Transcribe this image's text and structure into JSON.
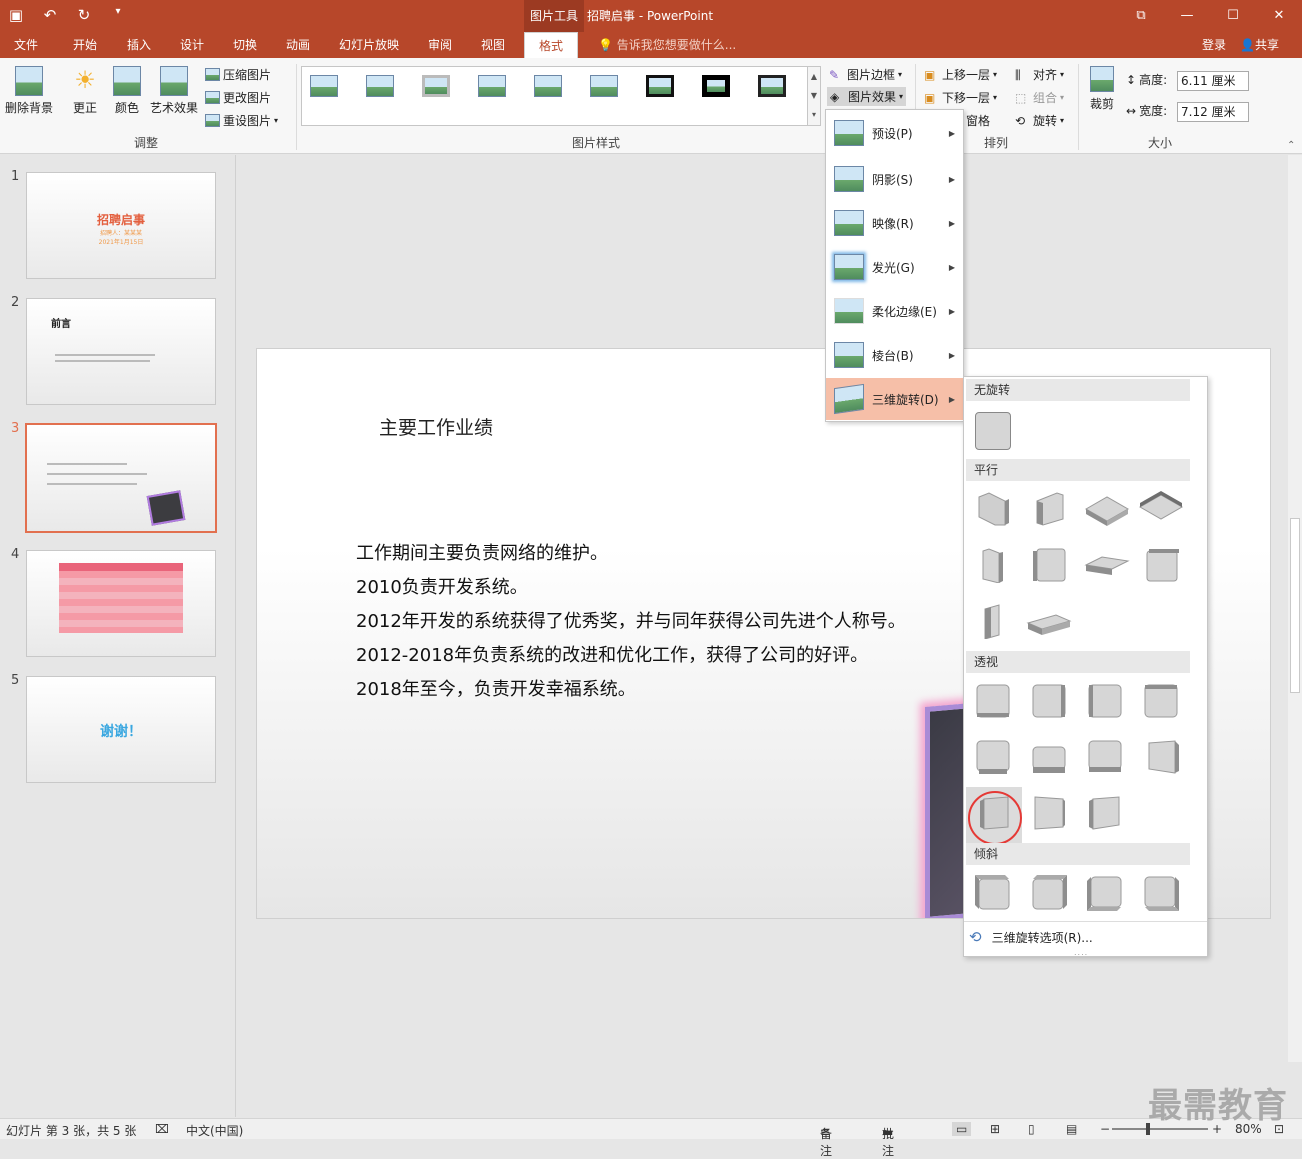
{
  "window": {
    "context_tab": "图片工具",
    "title": "招聘启事 - PowerPoint"
  },
  "tabs": [
    {
      "label": "文件"
    },
    {
      "label": "开始"
    },
    {
      "label": "插入"
    },
    {
      "label": "设计"
    },
    {
      "label": "切换"
    },
    {
      "label": "动画"
    },
    {
      "label": "幻灯片放映"
    },
    {
      "label": "审阅"
    },
    {
      "label": "视图"
    },
    {
      "label": "格式"
    }
  ],
  "tell_me": "告诉我您想要做什么...",
  "login": "登录",
  "share": "共享",
  "ribbon": {
    "remove_bg": "删除背景",
    "corrections": "更正",
    "color": "颜色",
    "artistic": "艺术效果",
    "compress": "压缩图片",
    "change": "更改图片",
    "reset": "重设图片",
    "group_adjust": "调整",
    "group_styles": "图片样式",
    "border": "图片边框",
    "effects": "图片效果",
    "bring_forward": "上移一层",
    "send_backward": "下移一层",
    "pane": "窗格",
    "align": "对齐",
    "group": "组合",
    "rotate": "旋转",
    "group_arrange": "排列",
    "crop": "裁剪",
    "height_label": "高度:",
    "height_value": "6.11 厘米",
    "width_label": "宽度:",
    "width_value": "7.12 厘米",
    "group_size": "大小"
  },
  "effects_menu": [
    {
      "label": "预设(P)"
    },
    {
      "label": "阴影(S)"
    },
    {
      "label": "映像(R)"
    },
    {
      "label": "发光(G)"
    },
    {
      "label": "柔化边缘(E)"
    },
    {
      "label": "棱台(B)"
    },
    {
      "label": "三维旋转(D)"
    }
  ],
  "rotation_menu": {
    "no_rotation": "无旋转",
    "parallel": "平行",
    "perspective": "透视",
    "oblique": "倾斜",
    "options": "三维旋转选项(R)..."
  },
  "slides": [
    {
      "num": "1",
      "title": "招聘启事",
      "sub1": "招聘人：某某某",
      "sub2": "2021年1月15日"
    },
    {
      "num": "2",
      "title": "前言"
    },
    {
      "num": "3"
    },
    {
      "num": "4"
    },
    {
      "num": "5",
      "title": "谢谢！"
    }
  ],
  "slide": {
    "title": "主要工作业绩",
    "bullets": [
      "工作期间主要负责网络的维护。",
      "2010负责开发系统。",
      "2012年开发的系统获得了优秀奖，并与同年获得公司先进个人称号。",
      "2012-2018年负责系统的改进和优化工作，获得了公司的好评。",
      "2018年至今，负责开发幸福系统。"
    ]
  },
  "status": {
    "slide_info": "幻灯片 第 3 张，共 5 张",
    "language": "中文(中国)",
    "notes": "备注",
    "comments": "批注",
    "zoom": "80%"
  },
  "watermark": "最需教育",
  "colors": {
    "accent": "#b7472a",
    "highlight": "#f6bfa8"
  }
}
